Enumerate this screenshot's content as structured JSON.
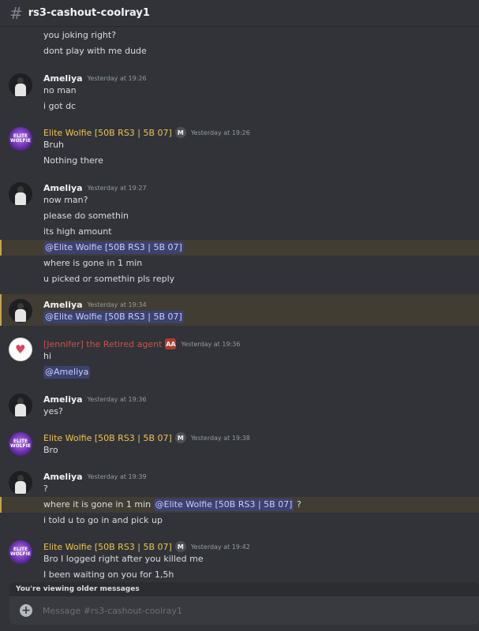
{
  "channel": {
    "name": "rs3-cashout-coolray1"
  },
  "messages": {
    "g0": {
      "l1": "you joking right?",
      "l2": "dont play with me dude"
    },
    "g1": {
      "author": "Ameliya",
      "time": "Yesterday at 19:26",
      "l1": "no man",
      "l2": "i got dc"
    },
    "g2": {
      "author": "Elite Wolfie [50B RS3 | 5B 07]",
      "badge": "M",
      "time": "Yesterday at 19:26",
      "l1": "Bruh",
      "l2": "Nothing there"
    },
    "g3": {
      "author": "Ameliya",
      "time": "Yesterday at 19:27",
      "l1": "now man?",
      "l2": "please do somethin",
      "l3": "its high amount",
      "l4_mention": "@Elite Wolfie [50B RS3 | 5B 07]",
      "l5": "where is gone in 1 min",
      "l6": "u picked or somethin pls reply"
    },
    "g4": {
      "author": "Ameliya",
      "time": "Yesterday at 19:34",
      "mention": "@Elite Wolfie [50B RS3 | 5B 07]"
    },
    "g5": {
      "author": "[Jennifer] the Retired agent",
      "badge": "AA",
      "time": "Yesterday at 19:36",
      "l1": "hi",
      "mention": "@Ameliya"
    },
    "g6": {
      "author": "Ameliya",
      "time": "Yesterday at 19:36",
      "l1": "yes?"
    },
    "g7": {
      "author": "Elite Wolfie [50B RS3 | 5B 07]",
      "badge": "M",
      "time": "Yesterday at 19:38",
      "l1": "Bro"
    },
    "g8": {
      "author": "Ameliya",
      "time": "Yesterday at 19:39",
      "l1": "?",
      "l2_pre": "where it is gone in 1 min ",
      "l2_mention": "@Elite Wolfie [50B RS3 | 5B 07]",
      "l2_post": " ?",
      "l3": "i told u to go in and pick up"
    },
    "g9": {
      "author": "Elite Wolfie [50B RS3 | 5B 07]",
      "badge": "M",
      "time": "Yesterday at 19:42",
      "l1": "Bro I logged right after you killed me",
      "l2": "I been waiting on you for 1,5h"
    }
  },
  "avatar_text": {
    "wolfie": "ELITE WOLFIE",
    "jennifer_heart": "♥"
  },
  "footer": {
    "older_notice": "You're viewing older messages",
    "composer_placeholder": "Message #rs3-cashout-coolray1"
  },
  "colors": {
    "background": "#313338",
    "highlight": "#413d33",
    "mention_bg": "#3c4270",
    "wolfie_name": "#f0c44c",
    "jennifer_name": "#c9534a"
  }
}
